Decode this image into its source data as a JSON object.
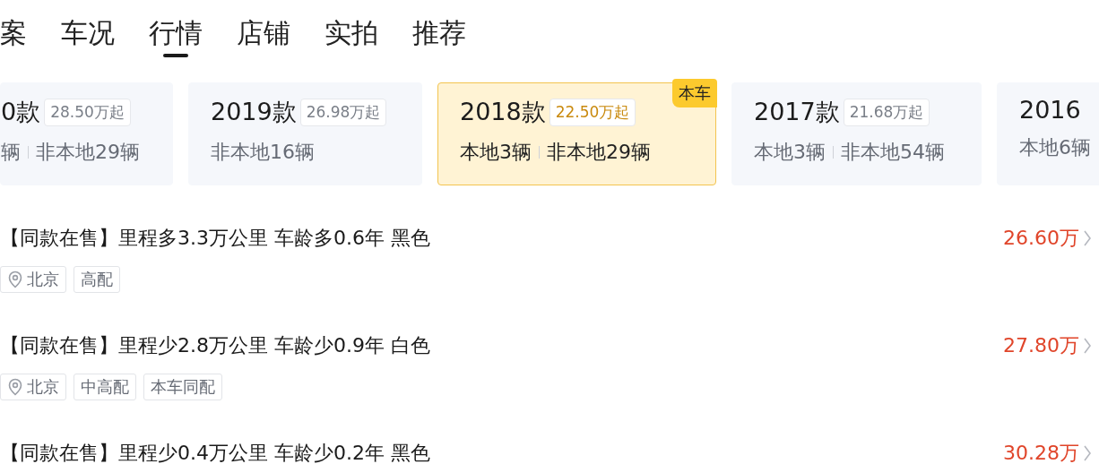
{
  "tabs": [
    {
      "label": "案",
      "selected": false
    },
    {
      "label": "车况",
      "selected": false
    },
    {
      "label": "行情",
      "selected": true
    },
    {
      "label": "店铺",
      "selected": false
    },
    {
      "label": "实拍",
      "selected": false
    },
    {
      "label": "推荐",
      "selected": false
    }
  ],
  "year_cards": [
    {
      "year": "0款",
      "price": "28.50万起",
      "counts": [
        "辆",
        "非本地29辆"
      ],
      "selected": false
    },
    {
      "year": "2019款",
      "price": "26.98万起",
      "counts": [
        "非本地16辆"
      ],
      "selected": false
    },
    {
      "year": "2018款",
      "price": "22.50万起",
      "counts": [
        "本地3辆",
        "非本地29辆"
      ],
      "selected": true,
      "badge": "本车"
    },
    {
      "year": "2017款",
      "price": "21.68万起",
      "counts": [
        "本地3辆",
        "非本地54辆"
      ],
      "selected": false
    },
    {
      "year": "2016",
      "counts": [
        "本地6辆"
      ],
      "selected": false
    }
  ],
  "listings": [
    {
      "title": "【同款在售】里程多3.3万公里 车龄多0.6年 黑色",
      "price": "26.60万",
      "tags": [
        {
          "kind": "location",
          "label": "北京"
        },
        {
          "kind": "plain",
          "label": "高配"
        }
      ]
    },
    {
      "title": "【同款在售】里程少2.8万公里 车龄少0.9年 白色",
      "price": "27.80万",
      "tags": [
        {
          "kind": "location",
          "label": "北京"
        },
        {
          "kind": "plain",
          "label": "中高配"
        },
        {
          "kind": "plain",
          "label": "本车同配"
        }
      ]
    },
    {
      "title": "【同款在售】里程少0.4万公里 车龄少0.2年 黑色",
      "price": "30.28万"
    }
  ]
}
